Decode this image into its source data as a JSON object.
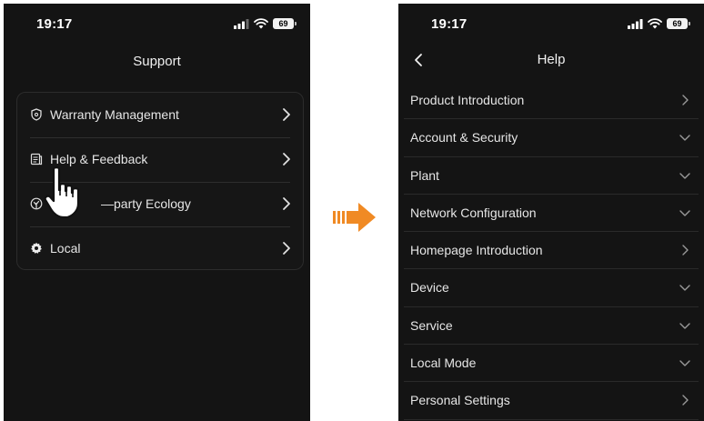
{
  "status": {
    "time": "19:17",
    "battery": "69"
  },
  "support_screen": {
    "title": "Support",
    "items": [
      {
        "label": "Warranty Management",
        "icon": "shield-icon"
      },
      {
        "label": "Help & Feedback",
        "icon": "document-icon"
      },
      {
        "label": "—party Ecology",
        "icon": "leaf-circle-icon"
      },
      {
        "label": "Local",
        "icon": "gear-icon"
      }
    ]
  },
  "help_screen": {
    "title": "Help",
    "items": [
      {
        "label": "Product Introduction",
        "icon": "chevron-right-icon"
      },
      {
        "label": "Account & Security",
        "icon": "chevron-down-icon"
      },
      {
        "label": "Plant",
        "icon": "chevron-down-icon"
      },
      {
        "label": "Network Configuration",
        "icon": "chevron-down-icon"
      },
      {
        "label": "Homepage Introduction",
        "icon": "chevron-right-icon"
      },
      {
        "label": "Device",
        "icon": "chevron-down-icon"
      },
      {
        "label": "Service",
        "icon": "chevron-down-icon"
      },
      {
        "label": "Local Mode",
        "icon": "chevron-down-icon"
      },
      {
        "label": "Personal Settings",
        "icon": "chevron-right-icon"
      }
    ]
  },
  "colors": {
    "background": "#141414",
    "arrow": "#F08A24",
    "text": "#E6E6E6",
    "divider": "#2A2A2A"
  }
}
